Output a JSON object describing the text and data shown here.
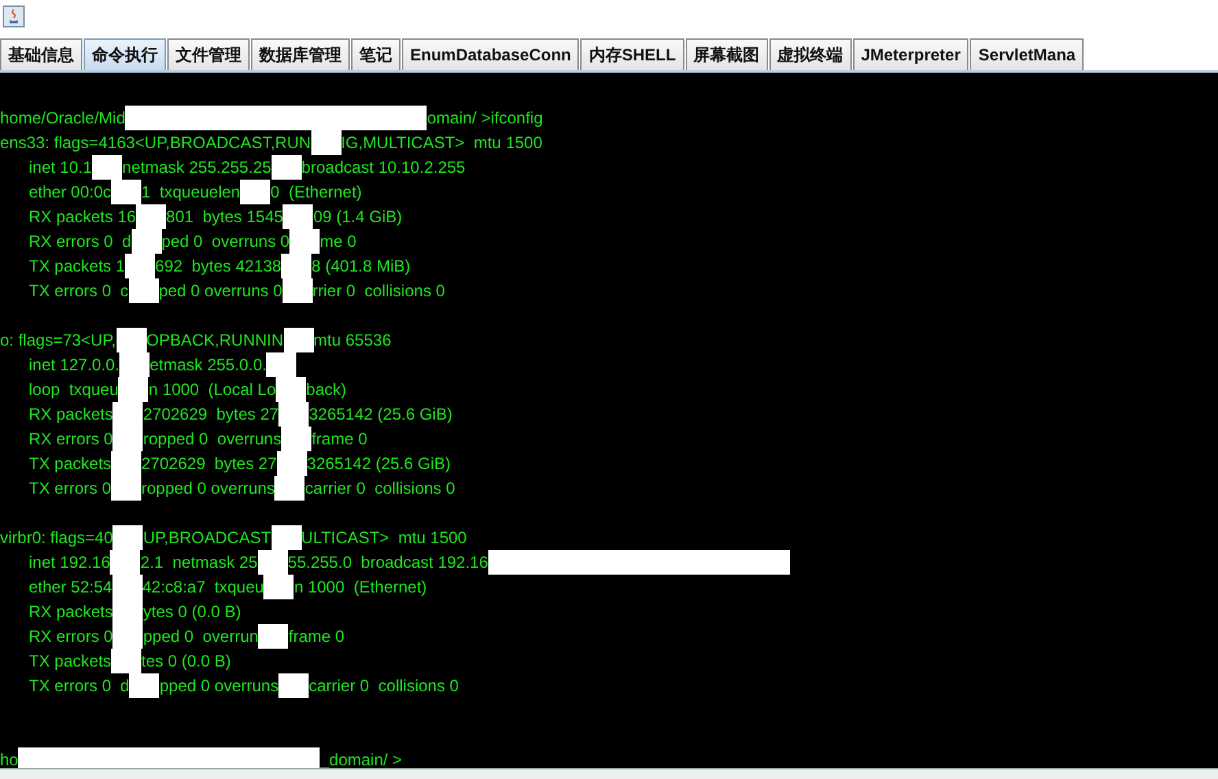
{
  "window": {
    "tabs": [
      {
        "label": "基础信息",
        "selected": false
      },
      {
        "label": "命令执行",
        "selected": true
      },
      {
        "label": "文件管理",
        "selected": false
      },
      {
        "label": "数据库管理",
        "selected": false
      },
      {
        "label": "笔记",
        "selected": false
      },
      {
        "label": "EnumDatabaseConn",
        "selected": false
      },
      {
        "label": "内存SHELL",
        "selected": false
      },
      {
        "label": "屏幕截图",
        "selected": false
      },
      {
        "label": "虚拟终端",
        "selected": false
      },
      {
        "label": "JMeterpreter",
        "selected": false
      },
      {
        "label": "ServletMana",
        "selected": false
      }
    ]
  },
  "terminal": {
    "lines": [
      {
        "kind": "text",
        "indent": false,
        "segments": [
          {
            "kind": "text",
            "text": "home/Oracle/Mid"
          },
          {
            "kind": "wide_redaction"
          },
          {
            "kind": "text",
            "text": "omain/ >ifconfig"
          }
        ]
      },
      {
        "kind": "text",
        "indent": false,
        "segments": [
          {
            "kind": "text",
            "text": "ens33: flags=4163<UP,BROADCAST,RUN"
          },
          {
            "kind": "redaction"
          },
          {
            "kind": "text",
            "text": "IG,MULTICAST>  mtu 1500"
          }
        ]
      },
      {
        "kind": "text",
        "indent": true,
        "segments": [
          {
            "kind": "text",
            "text": "inet 10.1"
          },
          {
            "kind": "redaction"
          },
          {
            "kind": "text",
            "text": "netmask 255.255.25"
          },
          {
            "kind": "redaction"
          },
          {
            "kind": "text",
            "text": "broadcast 10.10.2.255"
          }
        ]
      },
      {
        "kind": "text",
        "indent": true,
        "segments": [
          {
            "kind": "text",
            "text": "ether 00:0c"
          },
          {
            "kind": "redaction"
          },
          {
            "kind": "text",
            "text": "1  txqueuelen"
          },
          {
            "kind": "redaction"
          },
          {
            "kind": "text",
            "text": "0  (Ethernet)"
          }
        ]
      },
      {
        "kind": "text",
        "indent": true,
        "segments": [
          {
            "kind": "text",
            "text": "RX packets 16"
          },
          {
            "kind": "redaction"
          },
          {
            "kind": "text",
            "text": "801  bytes 1545"
          },
          {
            "kind": "redaction"
          },
          {
            "kind": "text",
            "text": "09 (1.4 GiB)"
          }
        ]
      },
      {
        "kind": "text",
        "indent": true,
        "segments": [
          {
            "kind": "text",
            "text": "RX errors 0  d"
          },
          {
            "kind": "redaction"
          },
          {
            "kind": "text",
            "text": "ped 0  overruns 0"
          },
          {
            "kind": "redaction"
          },
          {
            "kind": "text",
            "text": "me 0"
          }
        ]
      },
      {
        "kind": "text",
        "indent": true,
        "segments": [
          {
            "kind": "text",
            "text": "TX packets 1"
          },
          {
            "kind": "redaction"
          },
          {
            "kind": "text",
            "text": "692  bytes 42138"
          },
          {
            "kind": "redaction"
          },
          {
            "kind": "text",
            "text": "8 (401.8 MiB)"
          }
        ]
      },
      {
        "kind": "text",
        "indent": true,
        "segments": [
          {
            "kind": "text",
            "text": "TX errors 0  c"
          },
          {
            "kind": "redaction"
          },
          {
            "kind": "text",
            "text": "ped 0 overruns 0"
          },
          {
            "kind": "redaction"
          },
          {
            "kind": "text",
            "text": "rrier 0  collisions 0"
          }
        ]
      },
      {
        "kind": "blank"
      },
      {
        "kind": "text",
        "indent": false,
        "segments": [
          {
            "kind": "text",
            "text": "o: flags=73<UP,"
          },
          {
            "kind": "redaction"
          },
          {
            "kind": "text",
            "text": "OPBACK,RUNNIN"
          },
          {
            "kind": "redaction"
          },
          {
            "kind": "text",
            "text": "mtu 65536"
          }
        ]
      },
      {
        "kind": "text",
        "indent": true,
        "segments": [
          {
            "kind": "text",
            "text": "inet 127.0.0."
          },
          {
            "kind": "redaction"
          },
          {
            "kind": "text",
            "text": "etmask 255.0.0."
          },
          {
            "kind": "redaction"
          }
        ]
      },
      {
        "kind": "text",
        "indent": true,
        "segments": [
          {
            "kind": "text",
            "text": "loop  txqueu"
          },
          {
            "kind": "redaction"
          },
          {
            "kind": "text",
            "text": "n 1000  (Local Lo"
          },
          {
            "kind": "redaction"
          },
          {
            "kind": "text",
            "text": "back)"
          }
        ]
      },
      {
        "kind": "text",
        "indent": true,
        "segments": [
          {
            "kind": "text",
            "text": "RX packets"
          },
          {
            "kind": "redaction"
          },
          {
            "kind": "text",
            "text": "2702629  bytes 27"
          },
          {
            "kind": "redaction"
          },
          {
            "kind": "text",
            "text": "3265142 (25.6 GiB)"
          }
        ]
      },
      {
        "kind": "text",
        "indent": true,
        "segments": [
          {
            "kind": "text",
            "text": "RX errors 0"
          },
          {
            "kind": "redaction"
          },
          {
            "kind": "text",
            "text": "ropped 0  overruns"
          },
          {
            "kind": "redaction"
          },
          {
            "kind": "text",
            "text": "frame 0"
          }
        ]
      },
      {
        "kind": "text",
        "indent": true,
        "segments": [
          {
            "kind": "text",
            "text": "TX packets"
          },
          {
            "kind": "redaction"
          },
          {
            "kind": "text",
            "text": "2702629  bytes 27"
          },
          {
            "kind": "redaction"
          },
          {
            "kind": "text",
            "text": "3265142 (25.6 GiB)"
          }
        ]
      },
      {
        "kind": "text",
        "indent": true,
        "segments": [
          {
            "kind": "text",
            "text": "TX errors 0"
          },
          {
            "kind": "redaction"
          },
          {
            "kind": "text",
            "text": "ropped 0 overruns"
          },
          {
            "kind": "redaction"
          },
          {
            "kind": "text",
            "text": "carrier 0  collisions 0"
          }
        ]
      },
      {
        "kind": "blank"
      },
      {
        "kind": "text",
        "indent": false,
        "segments": [
          {
            "kind": "text",
            "text": "virbr0: flags=40"
          },
          {
            "kind": "redaction"
          },
          {
            "kind": "text",
            "text": "UP,BROADCAST"
          },
          {
            "kind": "redaction"
          },
          {
            "kind": "text",
            "text": "ULTICAST>  mtu 1500"
          }
        ]
      },
      {
        "kind": "text",
        "indent": true,
        "segments": [
          {
            "kind": "text",
            "text": "inet 192.16"
          },
          {
            "kind": "redaction"
          },
          {
            "kind": "text",
            "text": "2.1  netmask 25"
          },
          {
            "kind": "redaction"
          },
          {
            "kind": "text",
            "text": "55.255.0  broadcast 192.16"
          },
          {
            "kind": "wide_redaction"
          }
        ]
      },
      {
        "kind": "text",
        "indent": true,
        "segments": [
          {
            "kind": "text",
            "text": "ether 52:54"
          },
          {
            "kind": "redaction"
          },
          {
            "kind": "text",
            "text": "42:c8:a7  txqueu"
          },
          {
            "kind": "redaction"
          },
          {
            "kind": "text",
            "text": "n 1000  (Ethernet)"
          }
        ]
      },
      {
        "kind": "text",
        "indent": true,
        "segments": [
          {
            "kind": "text",
            "text": "RX packets"
          },
          {
            "kind": "redaction"
          },
          {
            "kind": "text",
            "text": "ytes 0 (0.0 B)"
          }
        ]
      },
      {
        "kind": "text",
        "indent": true,
        "segments": [
          {
            "kind": "text",
            "text": "RX errors 0"
          },
          {
            "kind": "redaction"
          },
          {
            "kind": "text",
            "text": "pped 0  overrun"
          },
          {
            "kind": "redaction"
          },
          {
            "kind": "text",
            "text": "frame 0"
          }
        ]
      },
      {
        "kind": "text",
        "indent": true,
        "segments": [
          {
            "kind": "text",
            "text": "TX packets"
          },
          {
            "kind": "redaction"
          },
          {
            "kind": "text",
            "text": "tes 0 (0.0 B)"
          }
        ]
      },
      {
        "kind": "text",
        "indent": true,
        "segments": [
          {
            "kind": "text",
            "text": "TX errors 0  d"
          },
          {
            "kind": "redaction"
          },
          {
            "kind": "text",
            "text": "pped 0 overruns"
          },
          {
            "kind": "redaction"
          },
          {
            "kind": "text",
            "text": "carrier 0  collisions 0"
          }
        ]
      },
      {
        "kind": "blank"
      },
      {
        "kind": "blank"
      },
      {
        "kind": "text",
        "indent": false,
        "segments": [
          {
            "kind": "text",
            "text": "ho"
          },
          {
            "kind": "wide_redaction"
          },
          {
            "kind": "text",
            "text": "_domain/ >"
          }
        ]
      }
    ]
  }
}
